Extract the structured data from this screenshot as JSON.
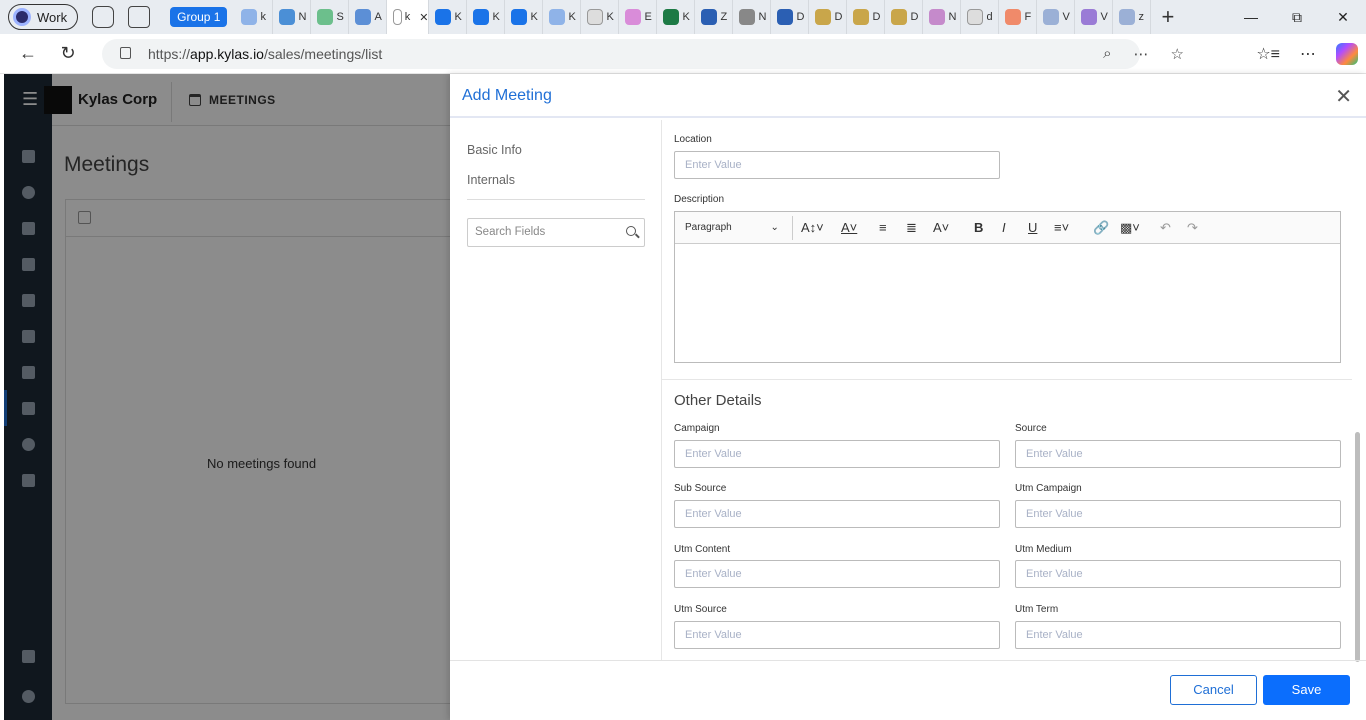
{
  "browser": {
    "profile_label": "Work",
    "group_label": "Group 1",
    "tabs": [
      {
        "label": "k",
        "icon": "kylas-favicon",
        "color": "#8fb3e8"
      },
      {
        "label": "N",
        "icon": "outlook-favicon",
        "color": "#4b8fd6"
      },
      {
        "label": "S",
        "icon": "green-favicon",
        "color": "#6cbf8c"
      },
      {
        "label": "A",
        "icon": "kylas-a-favicon",
        "color": "#5c8fd6"
      },
      {
        "label": "k",
        "icon": "kylas-favicon",
        "color": "#ffffff"
      },
      {
        "label": "K",
        "icon": "kylas-a-favicon",
        "color": "#1a73e8"
      },
      {
        "label": "K",
        "icon": "kylas-a-favicon",
        "color": "#1a73e8"
      },
      {
        "label": "K",
        "icon": "kylas-a-favicon",
        "color": "#1a73e8"
      },
      {
        "label": "K",
        "icon": "kylas-a-favicon",
        "color": "#8fb3e8"
      },
      {
        "label": "K",
        "icon": "page-favicon",
        "color": "#dddddd"
      },
      {
        "label": "E",
        "icon": "copilot-favicon",
        "color": "#d98cd9"
      },
      {
        "label": "K",
        "icon": "excel-favicon",
        "color": "#1d7a45"
      },
      {
        "label": "Z",
        "icon": "word-favicon",
        "color": "#2b5fb3"
      },
      {
        "label": "N",
        "icon": "openai-favicon",
        "color": "#888888"
      },
      {
        "label": "D",
        "icon": "word-favicon",
        "color": "#2b5fb3"
      },
      {
        "label": "D",
        "icon": "ai-favicon",
        "color": "#c9a64a"
      },
      {
        "label": "D",
        "icon": "ai-favicon",
        "color": "#c9a64a"
      },
      {
        "label": "D",
        "icon": "ai-favicon",
        "color": "#c9a64a"
      },
      {
        "label": "N",
        "icon": "ai-pink-favicon",
        "color": "#c58acb"
      },
      {
        "label": "d",
        "icon": "page-favicon",
        "color": "#dddddd"
      },
      {
        "label": "F",
        "icon": "orange-favicon",
        "color": "#f08a6a"
      },
      {
        "label": "V",
        "icon": "search-favicon",
        "color": "#9bb0d6"
      },
      {
        "label": "V",
        "icon": "purple-favicon",
        "color": "#9a7bd6"
      },
      {
        "label": "z",
        "icon": "search-favicon",
        "color": "#9bb0d6"
      }
    ],
    "url_scheme": "https://",
    "url_host": "app.kylas.io",
    "url_path": "/sales/meetings/list"
  },
  "app": {
    "company_name": "Kylas Corp",
    "module_label": "MEETINGS",
    "page_title": "Meetings",
    "empty_message": "No meetings found"
  },
  "modal": {
    "title": "Add Meeting",
    "nav": {
      "basic_info": "Basic Info",
      "internals": "Internals",
      "search_placeholder": "Search Fields"
    },
    "location_label": "Location",
    "location_placeholder": "Enter Value",
    "description_label": "Description",
    "editor_paragraph": "Paragraph",
    "other_details_title": "Other Details",
    "fields": [
      {
        "label": "Campaign",
        "placeholder": "Enter Value"
      },
      {
        "label": "Source",
        "placeholder": "Enter Value"
      },
      {
        "label": "Sub Source",
        "placeholder": "Enter Value"
      },
      {
        "label": "Utm Campaign",
        "placeholder": "Enter Value"
      },
      {
        "label": "Utm Content",
        "placeholder": "Enter Value"
      },
      {
        "label": "Utm Medium",
        "placeholder": "Enter Value"
      },
      {
        "label": "Utm Source",
        "placeholder": "Enter Value"
      },
      {
        "label": "Utm Term",
        "placeholder": "Enter Value"
      }
    ],
    "cancel_label": "Cancel",
    "save_label": "Save"
  },
  "colors": {
    "accent": "#1f6fd6",
    "save_button": "#0b6efd",
    "rail": "#1e2a38"
  }
}
